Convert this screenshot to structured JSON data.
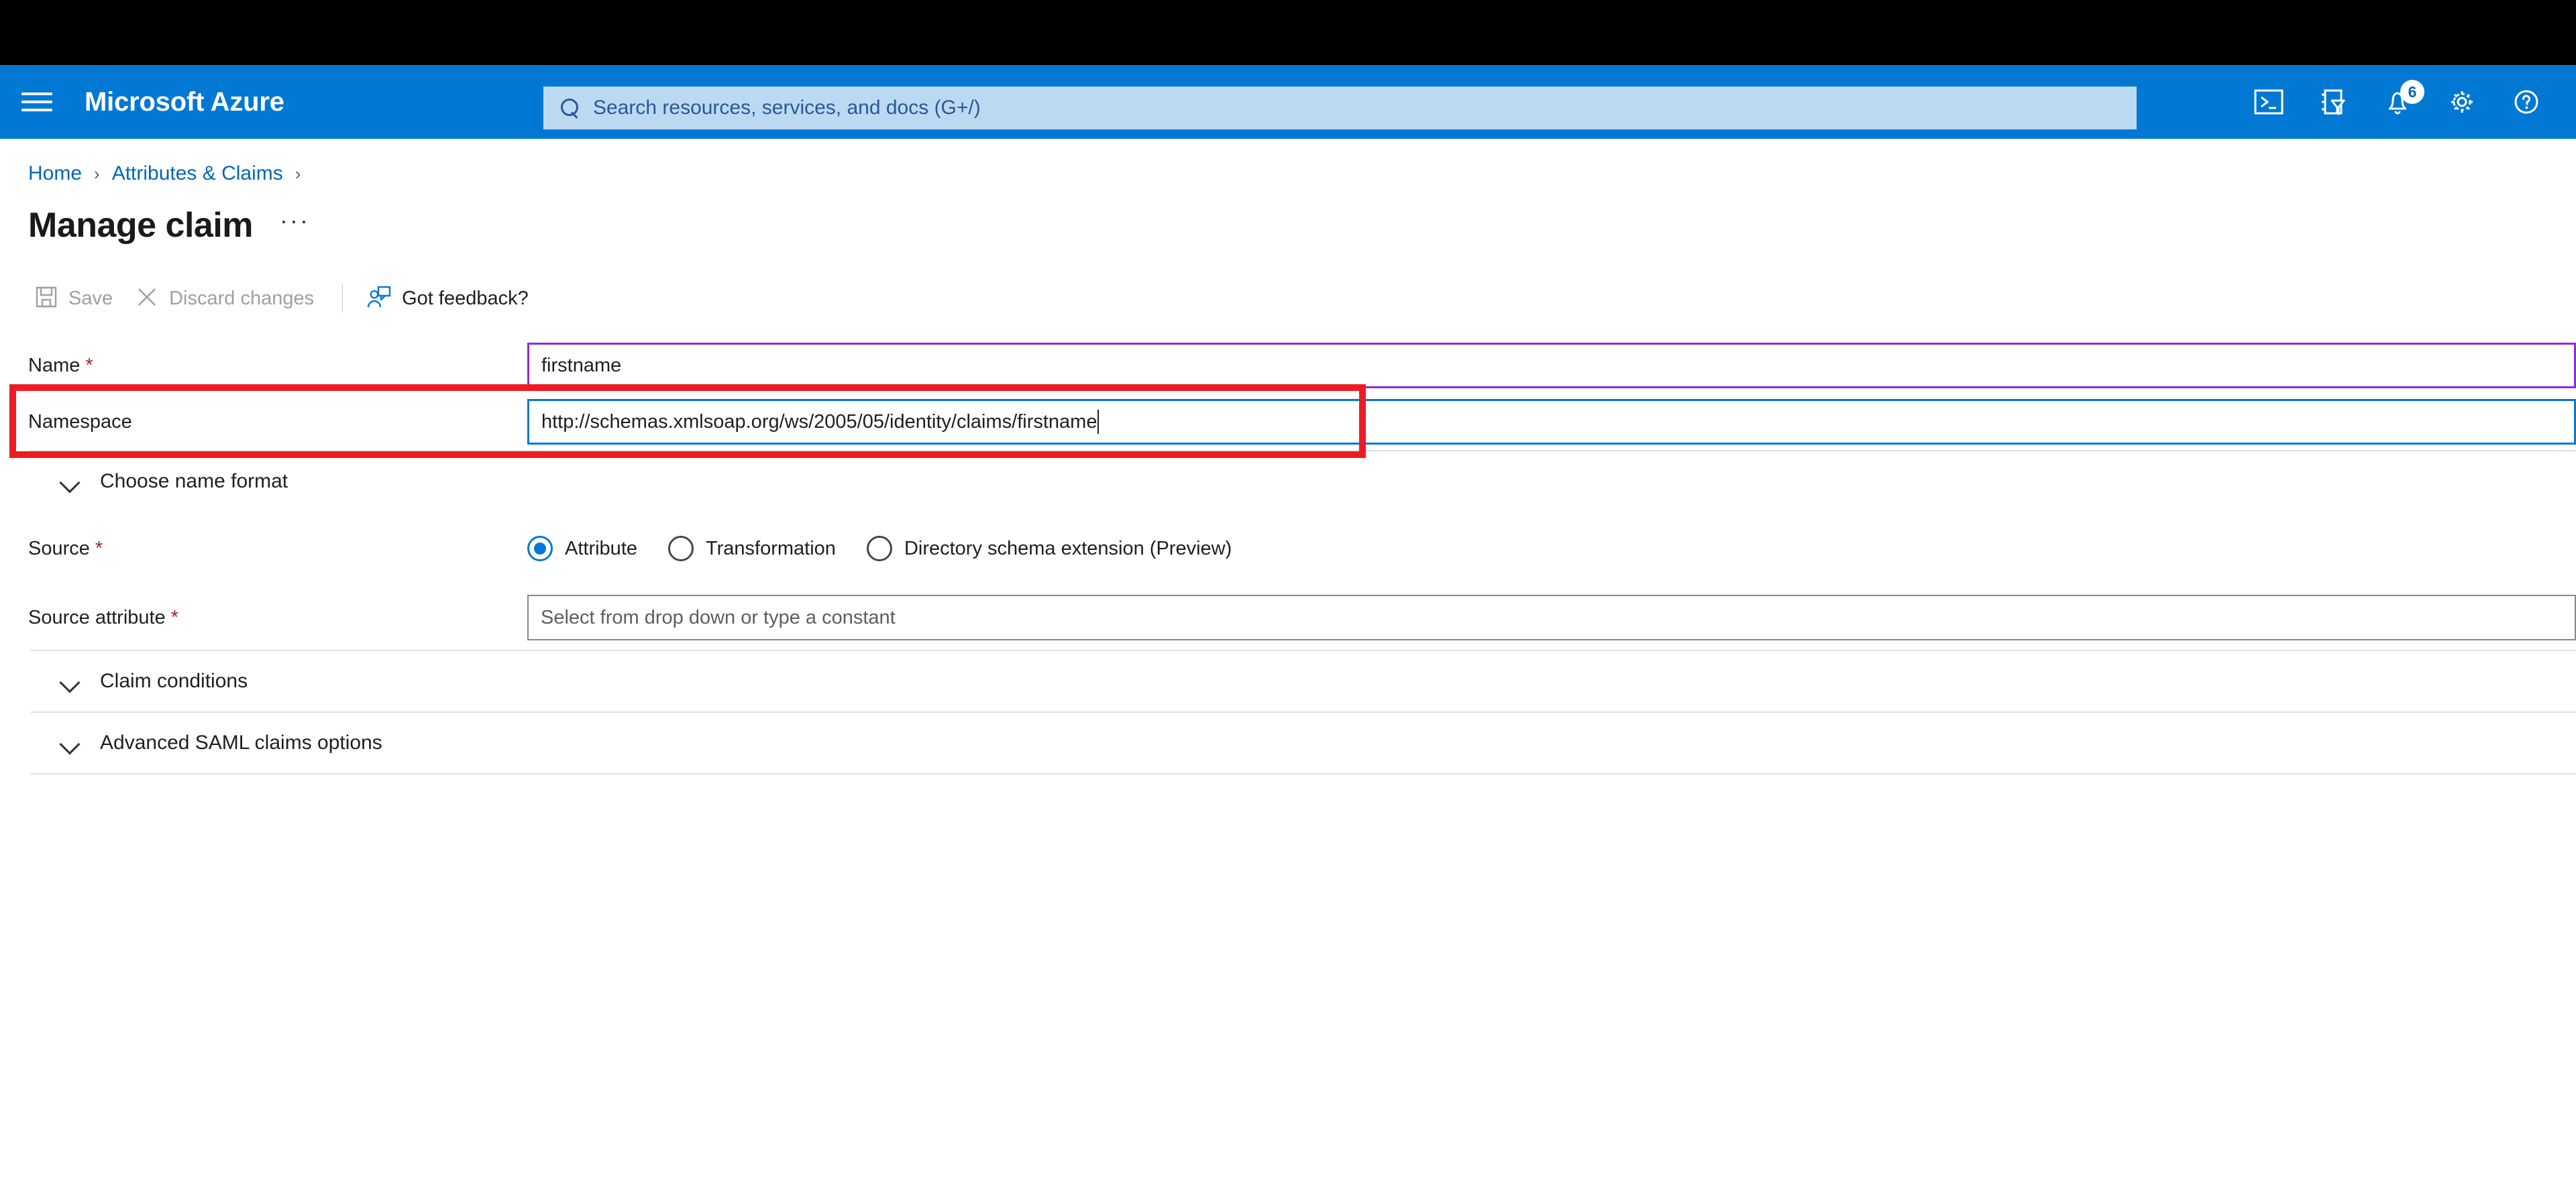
{
  "topbar": {
    "menu_icon": "hamburger-menu-icon",
    "brand": "Microsoft Azure",
    "search": {
      "placeholder": "Search resources, services, and docs (G+/)",
      "icon": "search-icon",
      "value": ""
    },
    "icons": [
      {
        "name": "cloud-shell-icon",
        "label": "Cloud Shell"
      },
      {
        "name": "directories-subscriptions-icon",
        "label": "Directories + subscriptions"
      },
      {
        "name": "notifications-bell-icon",
        "label": "Notifications",
        "badge": "6"
      },
      {
        "name": "settings-gear-icon",
        "label": "Settings"
      },
      {
        "name": "help-question-icon",
        "label": "Help"
      }
    ]
  },
  "breadcrumb": {
    "items": [
      "Home",
      "Attributes & Claims"
    ],
    "separator": "›",
    "trailing_separator": "›"
  },
  "page": {
    "title": "Manage claim",
    "more_menu": "···"
  },
  "commandbar": {
    "items": [
      {
        "name": "save-button",
        "label": "Save",
        "icon": "save-disk-icon",
        "disabled": true
      },
      {
        "name": "discard-changes-button",
        "label": "Discard changes",
        "icon": "close-x-icon",
        "disabled": true
      },
      {
        "name": "got-feedback-button",
        "label": "Got feedback?",
        "icon": "feedback-person-icon",
        "disabled": false
      }
    ]
  },
  "form": {
    "name_field": {
      "label": "Name",
      "required": "*",
      "value": "firstname",
      "placeholder": ""
    },
    "namespace_field": {
      "label": "Namespace",
      "required": "",
      "value": "http://schemas.xmlsoap.org/ws/2005/05/identity/claims/firstname",
      "placeholder": ""
    },
    "choose_name_format": {
      "label": "Choose name format"
    },
    "source_field": {
      "label": "Source",
      "required": "*",
      "options": [
        {
          "label": "Attribute",
          "checked": true
        },
        {
          "label": "Transformation",
          "checked": false
        },
        {
          "label": "Directory schema extension (Preview)",
          "checked": false
        }
      ]
    },
    "source_attribute_field": {
      "label": "Source attribute",
      "required": "*",
      "value": "",
      "placeholder": "Select from drop down or type a constant"
    },
    "claim_conditions": {
      "label": "Claim conditions"
    },
    "advanced_saml_claims_options": {
      "label": "Advanced SAML claims options"
    }
  },
  "annotation": {
    "name": "namespace-highlight-box",
    "color": "#ed1c24"
  },
  "colors": {
    "azure_blue": "#0078d4",
    "link_blue": "#0067b8",
    "search_bg": "#bcd9f2",
    "required_red": "#a4262c",
    "annotation_red": "#ed1c24",
    "focus_purple": "#8a2be2"
  }
}
